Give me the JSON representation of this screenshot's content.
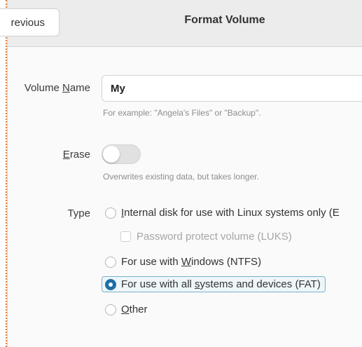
{
  "header": {
    "previous_label": "revious",
    "title": "Format Volume"
  },
  "volume_name": {
    "label_pre": "Volume ",
    "label_mnemonic": "N",
    "label_post": "ame",
    "value": "My",
    "hint": "For example: \"Angela's Files\" or \"Backup\"."
  },
  "erase": {
    "label_mnemonic": "E",
    "label_post": "rase",
    "state": "off",
    "hint": "Overwrites existing data, but takes longer."
  },
  "type": {
    "label": "Type",
    "options": [
      {
        "pre": "",
        "mnemonic": "I",
        "post": "nternal disk for use with Linux systems only (E",
        "selected": false
      },
      {
        "pre": "For use with ",
        "mnemonic": "W",
        "post": "indows (NTFS)",
        "selected": false
      },
      {
        "pre": "For use with all ",
        "mnemonic": "s",
        "post": "ystems and devices (FAT)",
        "selected": true
      },
      {
        "pre": "",
        "mnemonic": "O",
        "post": "ther",
        "selected": false
      }
    ],
    "password_checkbox": {
      "label": "Password protect volume (LUKS)",
      "checked": false,
      "enabled": false
    }
  },
  "colors": {
    "accent": "#1e6ea6",
    "selection_border": "#7bb0cc",
    "headerbar": "#ececec"
  }
}
